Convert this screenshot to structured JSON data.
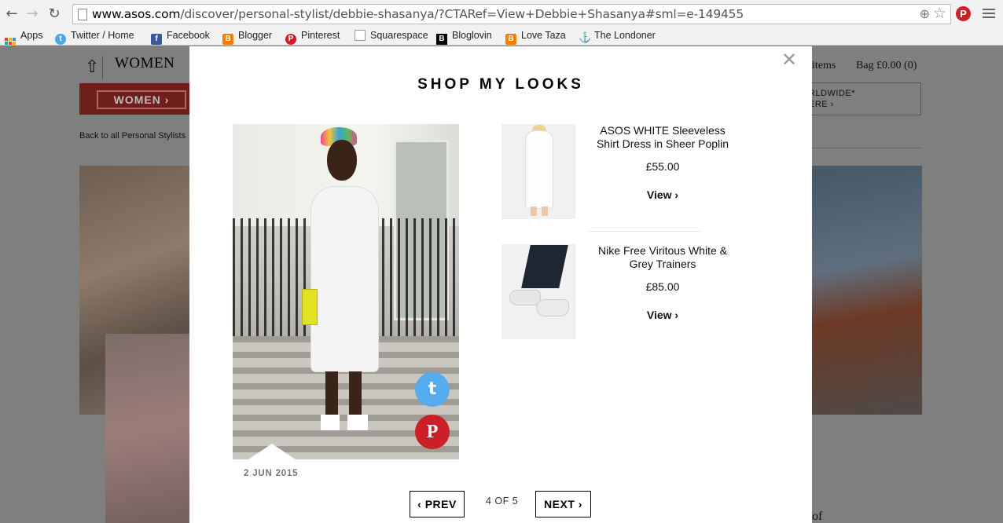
{
  "browser": {
    "url_domain": "www.asos.com",
    "url_path": "/discover/personal-stylist/debbie-shasanya/?CTARef=View+Debbie+Shasanya#sml=e-149455",
    "bookmarks": [
      {
        "label": "Apps",
        "icon": "apps-grid-icon"
      },
      {
        "label": "Twitter / Home",
        "icon": "twitter-icon"
      },
      {
        "label": "Facebook",
        "icon": "facebook-icon"
      },
      {
        "label": "Blogger",
        "icon": "blogger-icon"
      },
      {
        "label": "Pinterest",
        "icon": "pinterest-icon"
      },
      {
        "label": "Squarespace",
        "icon": "page-icon"
      },
      {
        "label": "Bloglovin",
        "icon": "bloglovin-icon"
      },
      {
        "label": "Love Taza",
        "icon": "blogger-icon"
      },
      {
        "label": "The Londoner",
        "icon": "anchor-icon"
      }
    ]
  },
  "page": {
    "nav_women": "WOMEN",
    "women_button": "WOMEN ›",
    "back_link": "Back to all Personal Stylists",
    "items_label": "items",
    "bag_label": "Bag  £0.00 (0)",
    "worldwide_line1": "RLDWIDE*",
    "worldwide_line2": "ERE ›",
    "trailing_text": "of"
  },
  "modal": {
    "title": "SHOP MY LOOKS",
    "date": "2 JUN 2015",
    "products": [
      {
        "name": "ASOS WHITE Sleeveless Shirt Dress in Sheer Poplin",
        "price": "£55.00",
        "view_label": "View ›"
      },
      {
        "name": "Nike Free Viritous White & Grey Trainers",
        "price": "£85.00",
        "view_label": "View ›"
      }
    ],
    "pager": {
      "prev": "‹ PREV",
      "count": "4 OF 5",
      "next": "NEXT ›"
    }
  },
  "colors": {
    "accent_red": "#d52b1e",
    "twitter_blue": "#55acee",
    "pinterest_red": "#cb2027"
  }
}
